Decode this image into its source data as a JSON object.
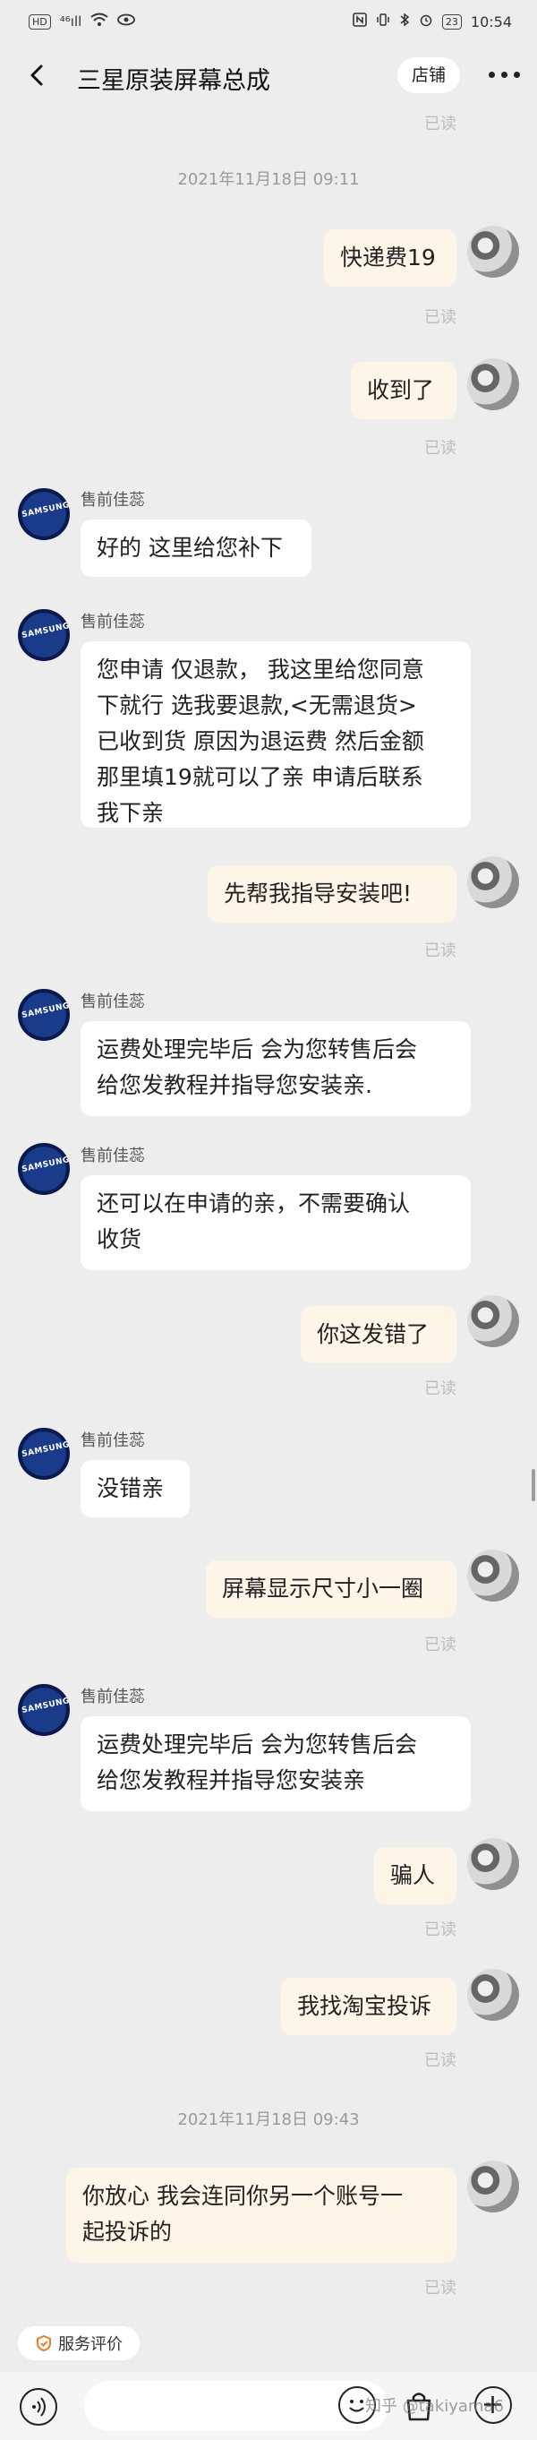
{
  "status_bar": {
    "left_chip": "HD",
    "signal_text": "⁴⁶ıll",
    "time": "10:54",
    "battery": "23"
  },
  "nav": {
    "title": "三星原装屏幕总成",
    "shop_label": "店铺"
  },
  "read_label": "已读",
  "timestamps": [
    "2021年11月18日 09:11",
    "2021年11月18日 09:43"
  ],
  "seller_name": "售前佳蕊",
  "seller_avatar_text": "SAMSUNG",
  "messages": [
    {
      "side": "right",
      "text": "快递费19"
    },
    {
      "side": "right",
      "text": "收到了"
    },
    {
      "side": "left",
      "text": "好的 这里给您补下"
    },
    {
      "side": "left",
      "lines": [
        "您申请 仅退款， 我这里给您同意",
        "下就行 选我要退款,<无需退货>",
        "已收到货 原因为退运费 然后金额",
        "那里填19就可以了亲 申请后联系",
        "我下亲"
      ]
    },
    {
      "side": "right",
      "text": "先帮我指导安装吧!"
    },
    {
      "side": "left",
      "lines": [
        "运费处理完毕后  会为您转售后会",
        "给您发教程并指导您安装亲."
      ]
    },
    {
      "side": "left",
      "lines": [
        "还可以在申请的亲，不需要确认",
        "收货"
      ]
    },
    {
      "side": "right",
      "text": "你这发错了"
    },
    {
      "side": "left",
      "text": "没错亲"
    },
    {
      "side": "right",
      "text": "屏幕显示尺寸小一圈"
    },
    {
      "side": "left",
      "lines": [
        "运费处理完毕后  会为您转售后会",
        "给您发教程并指导您安装亲"
      ]
    },
    {
      "side": "right",
      "text": "骗人"
    },
    {
      "side": "right",
      "text": "我找淘宝投诉"
    },
    {
      "side": "right",
      "lines": [
        "你放心 我会连同你另一个账号一",
        "起投诉的"
      ]
    }
  ],
  "bottom": {
    "service_label": "服务评价",
    "watermark": "知乎 @takiyama6"
  },
  "colors": {
    "background": "#ededed",
    "own_bubble": "#fdf6e8",
    "other_bubble": "#ffffff",
    "read_text": "#bdbdbd",
    "service_icon": "#f07b22"
  },
  "icons": [
    "back-arrow-icon",
    "more-icon",
    "voice-icon",
    "emoji-icon",
    "shopping-bag-icon",
    "plus-icon",
    "service-rating-icon"
  ]
}
